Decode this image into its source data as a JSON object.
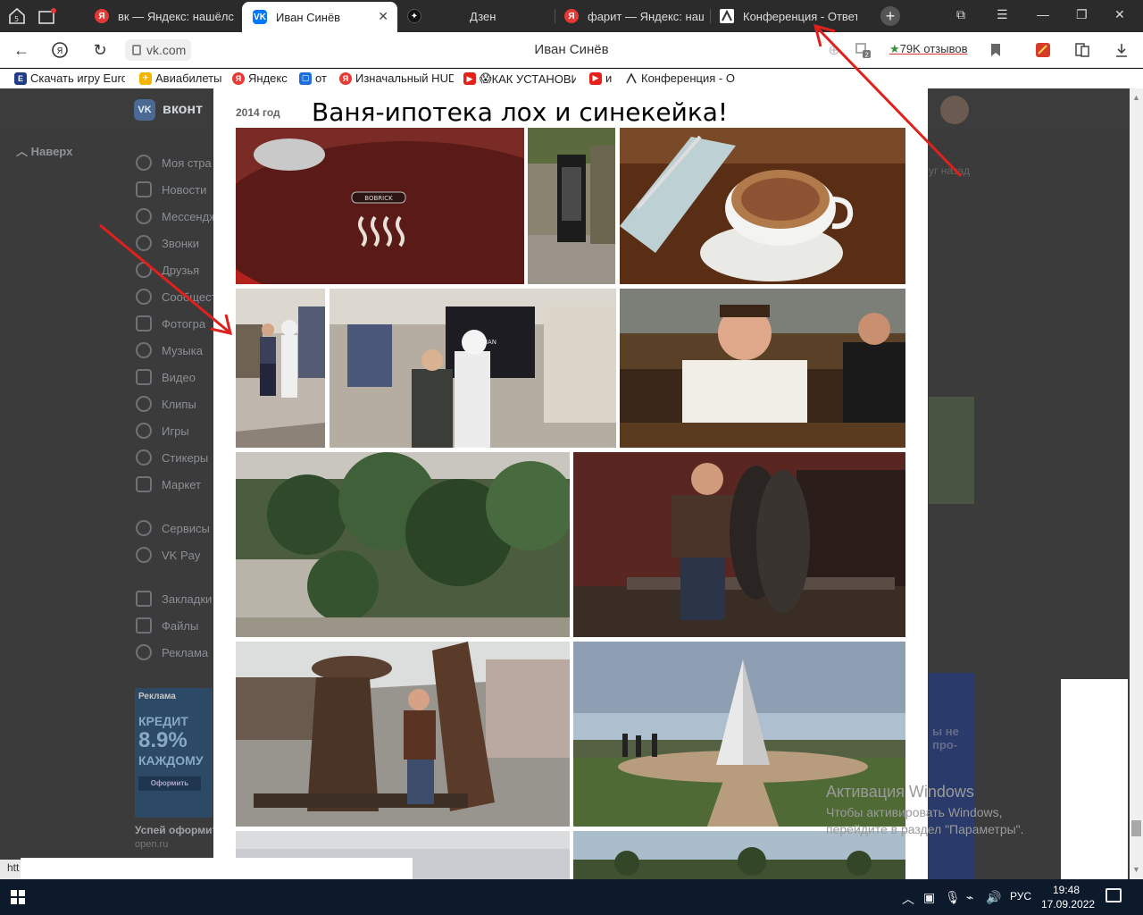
{
  "browser": {
    "tabs": [
      {
        "title": "вк — Яндекс: нашёлся",
        "favicon": "yandex-icon",
        "active": false
      },
      {
        "title": "Иван Синёв",
        "favicon": "vk-icon",
        "active": true
      },
      {
        "title": "Дзен",
        "favicon": "dzen-icon",
        "active": false
      },
      {
        "title": "фарит — Яндекс: наш",
        "favicon": "yandex-icon",
        "active": false
      },
      {
        "title": "Конференция - Ответ",
        "favicon": "conference-icon",
        "active": false
      }
    ],
    "url": "vk.com",
    "page_title": "Иван Синёв",
    "reviews": "79K отзывов",
    "badge_count": "2",
    "bookmarks": [
      "Скачать игру Euro",
      "Авиабилеты",
      "Яндекс",
      "от",
      "Изначальный HUD",
      "КАК УСТАНОВИ",
      "и",
      "Конференция - О"
    ],
    "status_url": "htt"
  },
  "vk": {
    "logo": "вконт",
    "up_link": "Наверх",
    "menu": [
      "Моя стра",
      "Новости",
      "Мессендж",
      "Звонки",
      "Друзья",
      "Сообщест",
      "Фотогра",
      "Музыка",
      "Видео",
      "Клипы",
      "Игры",
      "Стикеры",
      "Маркет",
      "Сервисы",
      "VK Pay",
      "Закладки",
      "Файлы",
      "Реклама"
    ],
    "ad": {
      "label": "Реклама",
      "line1": "КРЕДИТ",
      "line2": "8.9%",
      "line3": "КАЖДОМУ",
      "button": "Оформить",
      "title": "Успей оформит",
      "domain": "open.ru"
    },
    "right_text": "уг назад",
    "right_ad_text": "ы не про-"
  },
  "album": {
    "year": "2014 год",
    "title": "Ваня-ипотека лох и синекейка!",
    "photos": [
      {
        "name": "photo-hand-dryer",
        "caption": "BOBRICK"
      },
      {
        "name": "photo-phone-booth"
      },
      {
        "name": "photo-cappuccino"
      },
      {
        "name": "photo-stormtrooper-man"
      },
      {
        "name": "photo-stormtrooper-woman",
        "caption": "TOPMAN"
      },
      {
        "name": "photo-man-in-pub"
      },
      {
        "name": "photo-indoor-garden"
      },
      {
        "name": "photo-bronze-statues"
      },
      {
        "name": "photo-mushroom-sculpture"
      },
      {
        "name": "photo-pyramid-monument"
      },
      {
        "name": "photo-sky-1"
      },
      {
        "name": "photo-sky-2"
      }
    ]
  },
  "watermark": {
    "title": "Активация Windows",
    "text": "Чтобы активировать Windows, перейдите в раздел \"Параметры\"."
  },
  "taskbar": {
    "lang": "РУС",
    "time": "19:48",
    "date": "17.09.2022"
  },
  "colors": {
    "vk_blue": "#0077ff",
    "yandex_red": "#e53935",
    "arrow_red": "#e0201c"
  }
}
